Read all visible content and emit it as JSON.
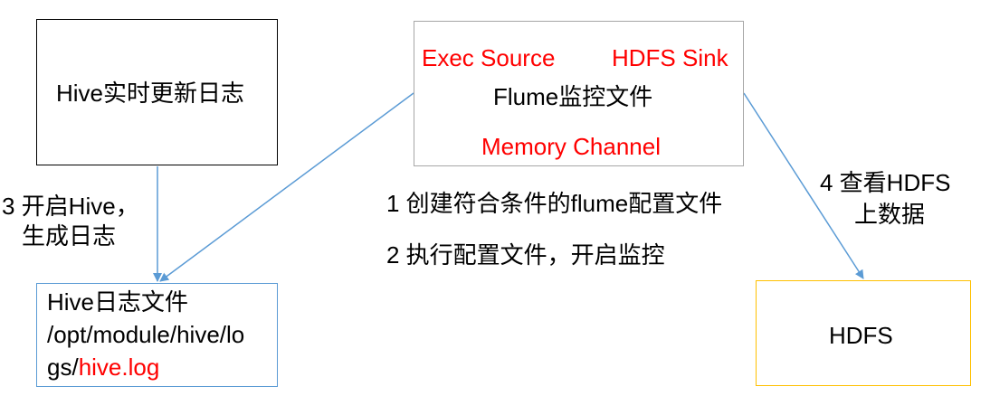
{
  "nodes": {
    "hive_realtime_log": "Hive实时更新日志",
    "flume": {
      "exec_source": "Exec Source",
      "hdfs_sink": "HDFS Sink",
      "title": "Flume监控文件",
      "memory_channel": "Memory Channel"
    },
    "hive_log_file": {
      "line1": "Hive日志文件",
      "line2": "/opt/module/hive/lo",
      "line3_prefix": "gs/",
      "line3_highlight": "hive.log"
    },
    "hdfs": "HDFS"
  },
  "steps": {
    "step1": "1 创建符合条件的flume配置文件",
    "step2": "2 执行配置文件，开启监控",
    "step3_line1": "3 开启Hive，",
    "step3_line2": "生成日志",
    "step4_line1": "4 查看HDFS",
    "step4_line2": "上数据"
  },
  "colors": {
    "arrow": "#5b9bd5",
    "highlight": "#ff0000",
    "hdfs_border": "#ffc000",
    "log_file_border": "#5b9bd5",
    "flume_border": "#a6a6a6"
  }
}
